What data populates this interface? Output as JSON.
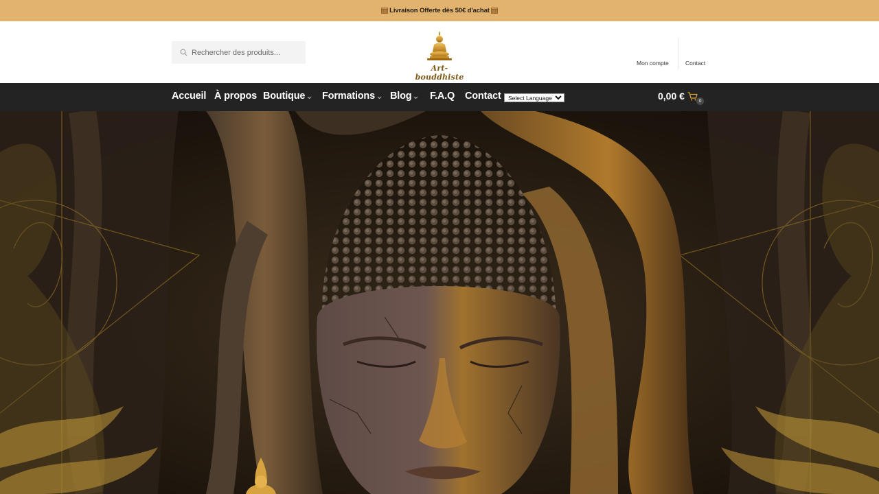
{
  "promo": {
    "text": "Livraison Offerte dès 50€ d'achat",
    "left_icon": "package-icon",
    "right_icon": "package-icon"
  },
  "header": {
    "search": {
      "placeholder": "Rechercher des produits...",
      "value": "",
      "icon": "search-icon"
    },
    "logo": {
      "text": "Art-bouddhiste",
      "icon": "buddha-logo-icon"
    },
    "links": [
      {
        "label": "Mon compte"
      },
      {
        "label": "Contact"
      }
    ]
  },
  "nav": {
    "items": [
      {
        "label": "Accueil",
        "has_dropdown": false
      },
      {
        "label": "À propos",
        "has_dropdown": false
      },
      {
        "label": "Boutique",
        "has_dropdown": true
      },
      {
        "label": "Formations",
        "has_dropdown": true
      },
      {
        "label": "Blog",
        "has_dropdown": true
      },
      {
        "label": "F.A.Q",
        "has_dropdown": false
      },
      {
        "label": "Contact",
        "has_dropdown": false
      }
    ],
    "language_select": {
      "selected": "Select Language"
    },
    "cart": {
      "total": "0,00 €",
      "count": "0",
      "icon": "cart-icon"
    }
  },
  "hero": {
    "image": "buddha-head-in-tree-roots"
  },
  "colors": {
    "promo_bar": "#e2b36f",
    "nav_bar": "#232323",
    "accent_gold": "#e0a43a",
    "logo_brown": "#7d5a15"
  }
}
